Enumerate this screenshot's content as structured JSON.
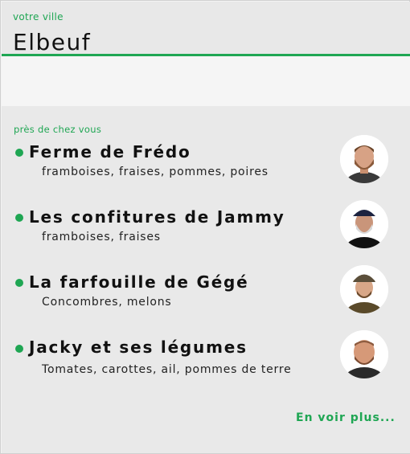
{
  "header": {
    "city_label": "votre ville",
    "city_value": "Elbeuf"
  },
  "nearby": {
    "title": "près de chez vous",
    "producers": [
      {
        "name": "Ferme de Frédo",
        "products": "framboises, fraises, pommes, poires",
        "avatar_icon": "producer-photo"
      },
      {
        "name": "Les confitures de Jammy",
        "products": "framboises, fraises",
        "avatar_icon": "producer-photo"
      },
      {
        "name": "La farfouille de Gégé",
        "products": "Concombres, melons",
        "avatar_icon": "producer-photo"
      },
      {
        "name": "Jacky et ses légumes",
        "products": "Tomates, carottes, ail, pommes de terre",
        "avatar_icon": "producer-photo"
      }
    ],
    "more_label": "En voir plus..."
  },
  "colors": {
    "accent": "#1fa653",
    "panel": "#e9e9e9"
  }
}
